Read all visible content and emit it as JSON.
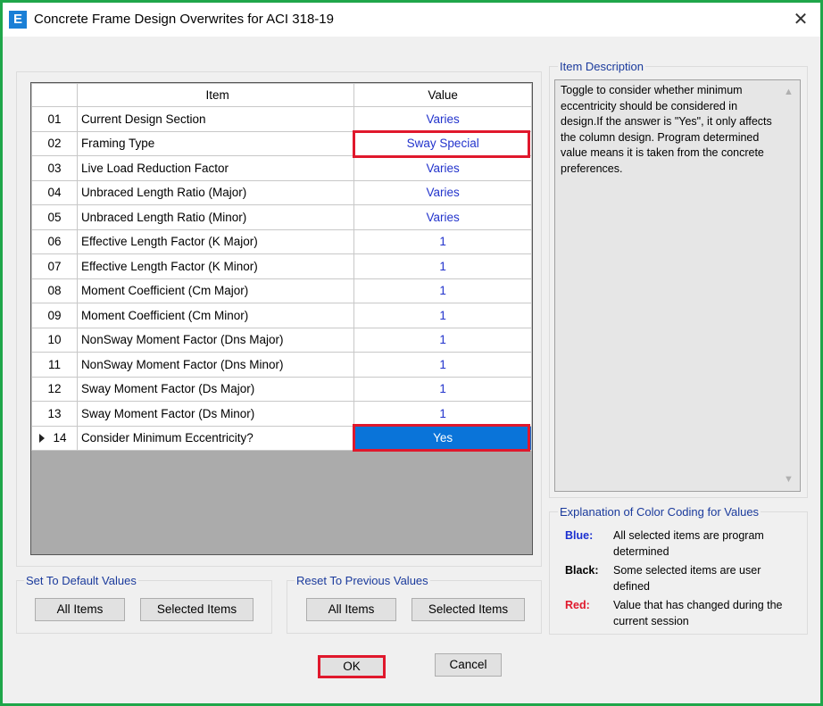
{
  "window": {
    "app_icon_letter": "E",
    "title": "Concrete Frame Design Overwrites for ACI 318-19",
    "close_symbol": "✕"
  },
  "grid": {
    "headers": {
      "number": "",
      "item": "Item",
      "value": "Value"
    },
    "rows": [
      {
        "num": "01",
        "item": "Current Design Section",
        "value": "Varies"
      },
      {
        "num": "02",
        "item": "Framing Type",
        "value": "Sway Special"
      },
      {
        "num": "03",
        "item": "Live Load Reduction Factor",
        "value": "Varies"
      },
      {
        "num": "04",
        "item": "Unbraced Length Ratio (Major)",
        "value": "Varies"
      },
      {
        "num": "05",
        "item": "Unbraced Length Ratio (Minor)",
        "value": "Varies"
      },
      {
        "num": "06",
        "item": "Effective Length Factor (K Major)",
        "value": "1"
      },
      {
        "num": "07",
        "item": "Effective Length Factor (K Minor)",
        "value": "1"
      },
      {
        "num": "08",
        "item": "Moment Coefficient (Cm Major)",
        "value": "1"
      },
      {
        "num": "09",
        "item": "Moment Coefficient (Cm Minor)",
        "value": "1"
      },
      {
        "num": "10",
        "item": "NonSway Moment Factor (Dns Major)",
        "value": "1"
      },
      {
        "num": "11",
        "item": "NonSway Moment Factor (Dns Minor)",
        "value": "1"
      },
      {
        "num": "12",
        "item": "Sway Moment Factor (Ds Major)",
        "value": "1"
      },
      {
        "num": "13",
        "item": "Sway Moment Factor (Ds Minor)",
        "value": "1"
      },
      {
        "num": "14",
        "item": "Consider Minimum Eccentricity?",
        "value": "Yes"
      }
    ]
  },
  "description": {
    "label": "Item Description",
    "text": "Toggle to consider whether minimum eccentricity should be considered in design.If the answer is \"Yes\", it only affects the column design. Program determined value means it is taken from the concrete preferences."
  },
  "legend": {
    "label": "Explanation of Color Coding for Values",
    "items": [
      {
        "key": "Blue:",
        "text": "All selected items are program determined",
        "color": "#1a2fd0"
      },
      {
        "key": "Black:",
        "text": "Some selected items are user defined",
        "color": "#000000"
      },
      {
        "key": "Red:",
        "text": "Value that has changed during the current session",
        "color": "#e0182c"
      }
    ]
  },
  "defaults_group": {
    "label": "Set To Default Values",
    "all_items": "All Items",
    "selected_items": "Selected Items"
  },
  "reset_group": {
    "label": "Reset To Previous Values",
    "all_items": "All Items",
    "selected_items": "Selected Items"
  },
  "footer": {
    "ok": "OK",
    "cancel": "Cancel"
  },
  "colors": {
    "accent_frame": "#1fa64a",
    "highlight_box": "#e0182c",
    "selection": "#0a74d9",
    "value_blue": "#2233cc"
  }
}
